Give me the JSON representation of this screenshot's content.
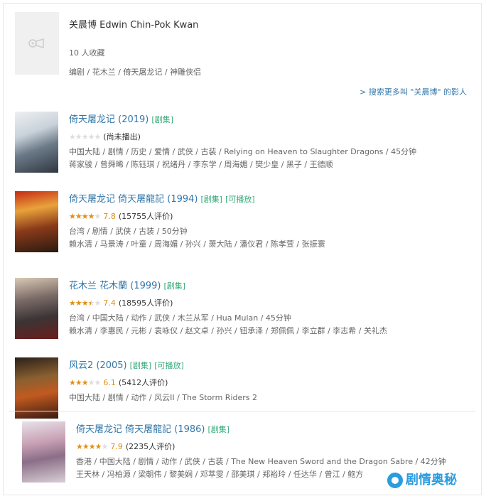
{
  "person": {
    "name": "关晨博 Edwin Chin-Pok Kwan",
    "collect": "10 人收藏",
    "works": "编剧 / 花木兰 / 倚天屠龙记 / 神雕侠侣",
    "photo_icon": "film-reel-icon"
  },
  "more_link": "> 搜索更多叫 \"关晨博\" 的影人",
  "items": [
    {
      "title": "倚天屠龙记 (2019)",
      "tags": [
        "[剧集]"
      ],
      "stars_on": 0,
      "score": "",
      "votes": "(尚未播出)",
      "meta": "中国大陆 / 剧情 / 历史 / 爱情 / 武侠 / 古装 / Relying on Heaven to Slaughter Dragons / 45分钟",
      "cast": "蒋家骏 / 曾舜晞 / 陈钰琪 / 祝绪丹 / 李东学 / 周海媚 / 樊少皇 / 黑子 / 王德顺"
    },
    {
      "title": "倚天屠龙记 倚天屠龍記 (1994)",
      "tags": [
        "[剧集]",
        "[可播放]"
      ],
      "stars_on": 4,
      "score": "7.8",
      "votes": "(15755人评价)",
      "meta": "台湾 / 剧情 / 武侠 / 古装 / 50分钟",
      "cast": "赖水清 / 马景涛 / 叶童 / 周海媚 / 孙兴 / 萧大陆 / 潘仪君 / 陈孝萱 / 张振寰"
    },
    {
      "title": "花木兰 花木蘭 (1999)",
      "tags": [
        "[剧集]"
      ],
      "stars_on": 3.5,
      "score": "7.4",
      "votes": "(18595人评价)",
      "meta": "台湾 / 中国大陆 / 动作 / 武侠 / 木兰从军 / Hua Mulan / 45分钟",
      "cast": "赖水清 / 李惠民 / 元彬 / 袁咏仪 / 赵文卓 / 孙兴 / 钮承泽 / 郑佩佩 / 李立群 / 李志希 / 关礼杰"
    },
    {
      "title": "风云2 (2005)",
      "tags": [
        "[剧集]",
        "[可播放]"
      ],
      "stars_on": 3,
      "score": "6.1",
      "votes": "(5412人评价)",
      "meta": "中国大陆 / 剧情 / 动作 / 风云II / The Storm Riders 2",
      "cast": ""
    },
    {
      "title": "倚天屠龙记 倚天屠龍記 (1986)",
      "tags": [
        "[剧集]"
      ],
      "stars_on": 4,
      "score": "7.9",
      "votes": "(2235人评价)",
      "meta": "香港 / 中国大陆 / 剧情 / 动作 / 武侠 / 古装 / The New Heaven Sword and the Dragon Sabre / 42分钟",
      "cast": "王天林 / 冯柏源 / 梁朝伟 / 黎美娴 / 邓萃雯 / 邵美琪 / 郑裕玲 / 任达华 / 曾江 / 鲍方"
    }
  ],
  "watermark": "剧情奥秘",
  "colors": {
    "link": "#3377aa",
    "tag": "#33aa77",
    "star": "#e09015",
    "watermark": "#2a9ce0"
  }
}
